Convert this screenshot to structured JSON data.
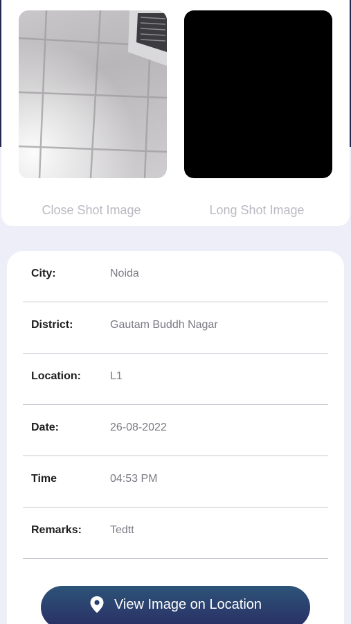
{
  "photos": {
    "close_shot_caption": "Close Shot Image",
    "long_shot_caption": "Long Shot Image"
  },
  "details": [
    {
      "label": "City:",
      "value": "Noida"
    },
    {
      "label": "District:",
      "value": "Gautam Buddh Nagar"
    },
    {
      "label": "Location:",
      "value": "L1"
    },
    {
      "label": "Date:",
      "value": "26-08-2022"
    },
    {
      "label": "Time",
      "value": "04:53 PM"
    },
    {
      "label": "Remarks:",
      "value": "Tedtt"
    }
  ],
  "action": {
    "label": "View Image on Location",
    "icon": "location-pin-icon"
  },
  "colors": {
    "header": "#23284f",
    "background": "#eeeef8",
    "button_top": "#2c5478",
    "button_bottom": "#2a2d64"
  }
}
